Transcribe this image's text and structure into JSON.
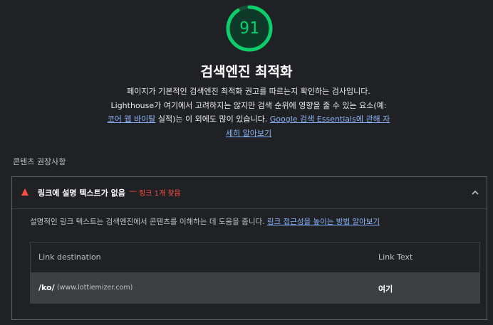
{
  "category": {
    "score": "91",
    "score_fraction": 0.91,
    "score_color": "#0cce6b",
    "title": "검색엔진 최적화",
    "description_text": "페이지가 기본적인 검색엔진 최적화 권고를 따르는지 확인하는 검사입니다. Lighthouse가 여기에서 고려하지는 않지만 검색 순위에 영향을 줄 수 있는 요소(예:",
    "description_link1": "코어 웹 바이탈",
    "description_mid": " 실적)는 이 외에도 많이 있습니다.",
    "description_link2": "Google 검색 Essentials에 관해 자세히 알아보기"
  },
  "group_title": "콘텐츠 권장사항",
  "audit": {
    "title": "링크에 설명 텍스트가 없음",
    "separator": "—",
    "display_value": "링크 1개 찾음",
    "fail_color": "#ff4e42",
    "description": "설명적인 링크 텍스트는 검색엔진에서 콘텐츠를 이해하는 데 도움을 줍니다.",
    "learn_more": "링크 접근성을 높이는 방법 알아보기"
  },
  "table": {
    "headers": {
      "destination": "Link destination",
      "text": "Link Text"
    },
    "rows": [
      {
        "path": "/ko/",
        "host": "(www.lottiemizer.com)",
        "text": "여기"
      }
    ]
  }
}
